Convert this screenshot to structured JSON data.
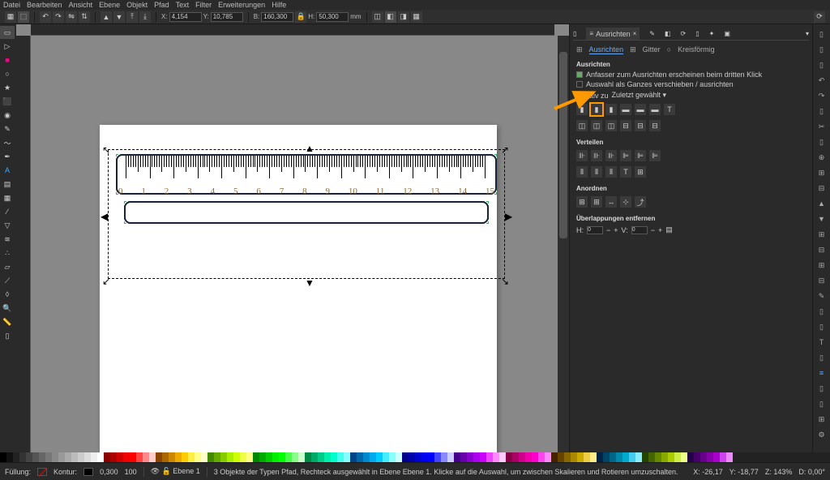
{
  "menu": [
    "Datei",
    "Bearbeiten",
    "Ansicht",
    "Ebene",
    "Objekt",
    "Pfad",
    "Text",
    "Filter",
    "Erweiterungen",
    "Hilfe"
  ],
  "toolbar": {
    "x_label": "X:",
    "x": "4,154",
    "y_label": "Y:",
    "y": "10,785",
    "w_label": "B:",
    "w": "160,300",
    "h_label": "H:",
    "h": "50,300",
    "unit": "mm"
  },
  "ruler_numbers": [
    "0",
    "1",
    "2",
    "3",
    "4",
    "5",
    "6",
    "7",
    "8",
    "9",
    "10",
    "11",
    "12",
    "13",
    "14",
    "15"
  ],
  "panel": {
    "tabs": {
      "align": "Ausrichten"
    },
    "subtabs": {
      "align": "Ausrichten",
      "grid": "Gitter",
      "circ": "Kreisförmig"
    },
    "sect_align": "Ausrichten",
    "cb1": "Anfasser zum Ausrichten erscheinen beim dritten Klick",
    "cb2": "Auswahl als Ganzes verschieben / ausrichten",
    "relativ_label": "Relativ zu",
    "relativ_val": "Zuletzt gewählt",
    "sect_dist": "Verteilen",
    "sect_arr": "Anordnen",
    "sect_overlap": "Überlappungen entfernen",
    "h_label": "H:",
    "h_val": "0",
    "v_label": "V:",
    "v_val": "0"
  },
  "status": {
    "fill_label": "Füllung:",
    "stroke_label": "Kontur:",
    "opacity": "100",
    "stroke_w": "0,300",
    "layer": "Ebene 1",
    "msg": "3 Objekte der Typen Pfad, Rechteck ausgewählt in Ebene Ebene 1. Klicke auf die Auswahl, um zwischen Skalieren und Rotieren umzuschalten.",
    "coord_x": "-26,17",
    "coord_y": "-18,77",
    "zoom": "143%",
    "rot": "0,00°"
  },
  "palette_colors": [
    "#000",
    "#111",
    "#222",
    "#333",
    "#444",
    "#555",
    "#666",
    "#777",
    "#888",
    "#999",
    "#aaa",
    "#bbb",
    "#ccc",
    "#ddd",
    "#eee",
    "#fff",
    "#800",
    "#a00",
    "#c00",
    "#e00",
    "#f00",
    "#f44",
    "#f88",
    "#fcc",
    "#840",
    "#a60",
    "#c80",
    "#ea0",
    "#fc0",
    "#fe4",
    "#ff8",
    "#ffc",
    "#480",
    "#6a0",
    "#8c0",
    "#ae0",
    "#cf0",
    "#ef4",
    "#ff8",
    "#080",
    "#0a0",
    "#0c0",
    "#0e0",
    "#0f0",
    "#4f4",
    "#8f8",
    "#cfc",
    "#084",
    "#0a6",
    "#0c8",
    "#0ea",
    "#0fc",
    "#4fe",
    "#8ff",
    "#048",
    "#06a",
    "#08c",
    "#0ae",
    "#0cf",
    "#4ef",
    "#8ff",
    "#cff",
    "#008",
    "#00a",
    "#00c",
    "#00e",
    "#00f",
    "#44f",
    "#88f",
    "#ccf",
    "#408",
    "#60a",
    "#80c",
    "#a0e",
    "#c0f",
    "#e4f",
    "#f8f",
    "#fcf",
    "#804",
    "#a06",
    "#c08",
    "#e0a",
    "#f0c",
    "#f4e",
    "#f8f",
    "#420",
    "#640",
    "#860",
    "#a80",
    "#ca0",
    "#ec4",
    "#fe8",
    "#024",
    "#046",
    "#068",
    "#08a",
    "#0ac",
    "#4ce",
    "#8ef",
    "#240",
    "#460",
    "#680",
    "#8a0",
    "#ac0",
    "#ce4",
    "#ef8",
    "#204",
    "#406",
    "#608",
    "#80a",
    "#a0c",
    "#c4e",
    "#e8f"
  ]
}
